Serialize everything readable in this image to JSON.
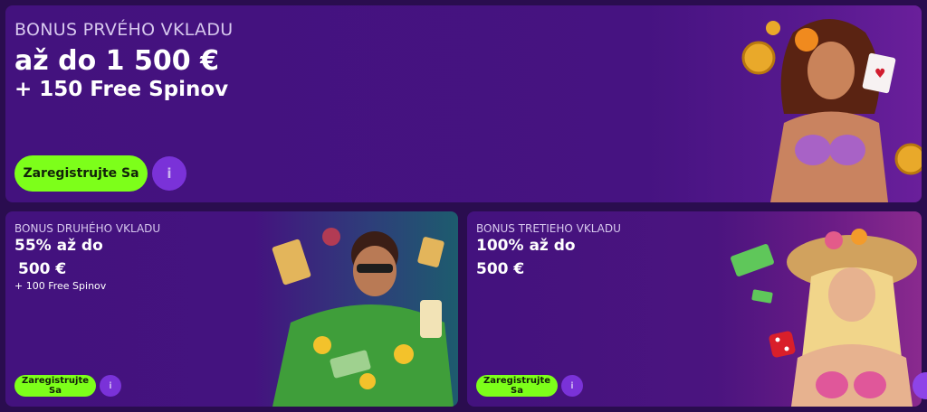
{
  "hero": {
    "eyebrow": "BONUS PRVÉHO VKLADU",
    "amount": "až do 1 500 €",
    "spins": "+ 150 Free Spinov",
    "cta_label": "Zaregistrujte Sa",
    "info_icon": "i"
  },
  "promo2": {
    "eyebrow": "BONUS DRUHÉHO VKLADU",
    "line1": "55% až do",
    "line2": "500 €",
    "spins": "+ 100 Free Spinov",
    "cta_label": "Zaregistrujte Sa",
    "info_icon": "i"
  },
  "promo3": {
    "eyebrow": "BONUS TRETIEHO VKLADU",
    "line1": "100% až do",
    "line2": "500 €",
    "cta_label": "Zaregistrujte Sa",
    "info_icon": "i"
  },
  "colors": {
    "background": "#2a0d4f",
    "card": "#43127e",
    "cta": "#7dff1a",
    "info": "#7a32d8"
  },
  "icons": [
    "info-icon",
    "coin-illustration",
    "playing-card-illustration",
    "poker-chip-illustration",
    "cash-illustration",
    "dice-illustration"
  ]
}
